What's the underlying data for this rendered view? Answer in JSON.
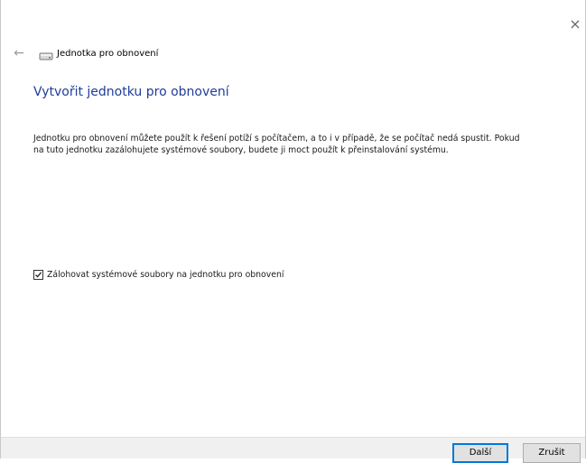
{
  "window": {
    "close_glyph": "×"
  },
  "header": {
    "back_glyph": "←",
    "drive_icon": "drive-icon",
    "title": "Jednotka pro obnovení"
  },
  "main": {
    "page_title": "Vytvořit jednotku pro obnovení",
    "description": "Jednotku pro obnovení můžete použít k řešení potíží s počítačem, a to i v případě, že se počítač nedá spustit. Pokud na tuto jednotku zazálohujete systémové soubory, budete ji moct použít k přeinstalování systému.",
    "checkbox": {
      "label": "Zálohovat systémové soubory na jednotku pro obnovení",
      "checked": true
    }
  },
  "footer": {
    "next_label": "Další",
    "cancel_label": "Zrušit"
  },
  "colors": {
    "title_accent": "#1f3d9a",
    "focus_border": "#0078d7",
    "footer_bg": "#f0f0f0"
  }
}
